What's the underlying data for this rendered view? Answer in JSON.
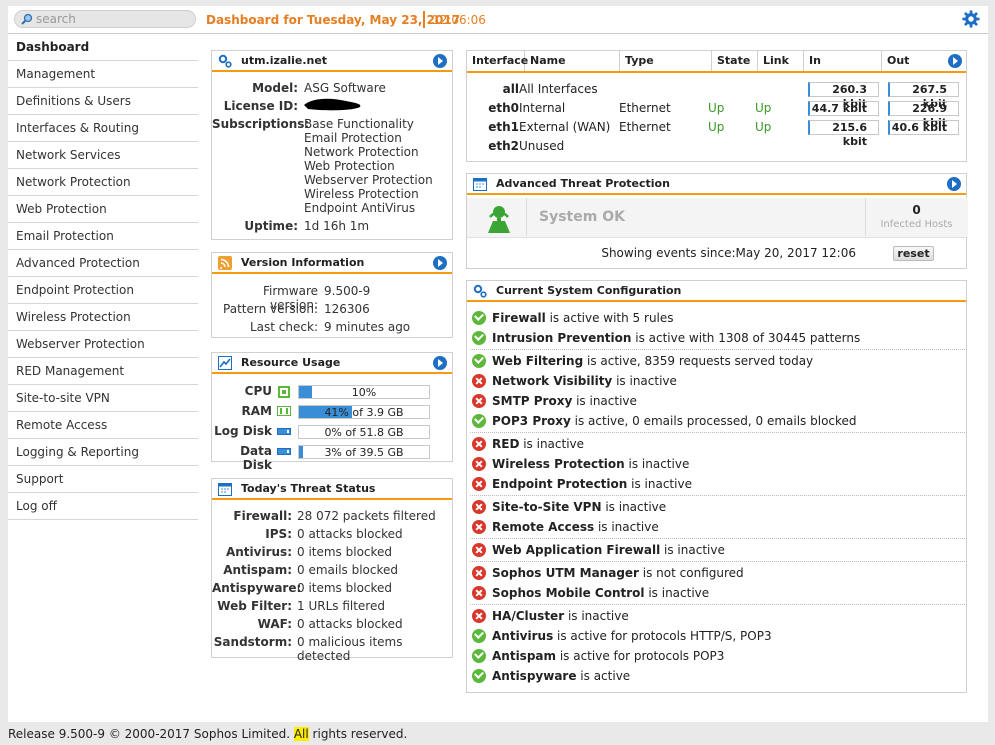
{
  "search": {
    "placeholder": "search"
  },
  "header": {
    "title": "Dashboard for Tuesday, May 23, 2017",
    "time": "12:06:06"
  },
  "sidebar": {
    "items": [
      {
        "label": "Dashboard"
      },
      {
        "label": "Management"
      },
      {
        "label": "Definitions & Users"
      },
      {
        "label": "Interfaces & Routing"
      },
      {
        "label": "Network Services"
      },
      {
        "label": "Network Protection"
      },
      {
        "label": "Web Protection"
      },
      {
        "label": "Email Protection"
      },
      {
        "label": "Advanced Protection"
      },
      {
        "label": "Endpoint Protection"
      },
      {
        "label": "Wireless Protection"
      },
      {
        "label": "Webserver Protection"
      },
      {
        "label": "RED Management"
      },
      {
        "label": "Site-to-site VPN"
      },
      {
        "label": "Remote Access"
      },
      {
        "label": "Logging & Reporting"
      },
      {
        "label": "Support"
      },
      {
        "label": "Log off"
      }
    ]
  },
  "system": {
    "title": "utm.izalie.net",
    "model_label": "Model:",
    "model": "ASG Software",
    "license_label": "License ID:",
    "subs_label": "Subscriptions:",
    "subscriptions": [
      "Base Functionality",
      "Email Protection",
      "Network Protection",
      "Web Protection",
      "Webserver Protection",
      "Wireless Protection",
      "Endpoint AntiVirus"
    ],
    "uptime_label": "Uptime:",
    "uptime": "1d 16h 1m"
  },
  "version": {
    "title": "Version Information",
    "firmware_label": "Firmware version:",
    "firmware": "9.500-9",
    "pattern_label": "Pattern version:",
    "pattern": "126306",
    "check_label": "Last check:",
    "check": "9 minutes ago"
  },
  "resources": {
    "title": "Resource Usage",
    "cpu": {
      "label": "CPU",
      "text": "10%",
      "pct": 10
    },
    "ram": {
      "label": "RAM",
      "text": "41% of 3.9 GB",
      "pct": 41
    },
    "logdisk": {
      "label": "Log Disk",
      "text": "0% of 51.8 GB",
      "pct": 0
    },
    "datadisk": {
      "label": "Data Disk",
      "text": "3% of 39.5 GB",
      "pct": 3
    }
  },
  "threat": {
    "title": "Today's Threat Status",
    "rows": [
      {
        "k": "Firewall:",
        "v": "28 072 packets filtered"
      },
      {
        "k": "IPS:",
        "v": "0 attacks blocked"
      },
      {
        "k": "Antivirus:",
        "v": "0 items blocked"
      },
      {
        "k": "Antispam:",
        "v": "0 emails blocked"
      },
      {
        "k": "Antispyware:",
        "v": "0 items blocked"
      },
      {
        "k": "Web Filter:",
        "v": "1 URLs filtered"
      },
      {
        "k": "WAF:",
        "v": "0 attacks blocked"
      },
      {
        "k": "Sandstorm:",
        "v": "0 malicious items detected"
      }
    ]
  },
  "interfaces": {
    "headers": {
      "interface": "Interface",
      "name": "Name",
      "type": "Type",
      "state": "State",
      "link": "Link",
      "in": "In",
      "out": "Out"
    },
    "rows": [
      {
        "iface": "all",
        "name": "All Interfaces",
        "type": "",
        "state": "",
        "link": "",
        "in": "260.3 kbit",
        "out": "267.5 kbit"
      },
      {
        "iface": "eth0",
        "name": "Internal",
        "type": "Ethernet",
        "state": "Up",
        "link": "Up",
        "in": "44.7 kbit",
        "out": "226.9 kbit"
      },
      {
        "iface": "eth1",
        "name": "External (WAN)",
        "type": "Ethernet",
        "state": "Up",
        "link": "Up",
        "in": "215.6 kbit",
        "out": "40.6 kbit"
      },
      {
        "iface": "eth2",
        "name": "Unused",
        "type": "",
        "state": "",
        "link": "",
        "in": "",
        "out": ""
      }
    ]
  },
  "atp": {
    "title": "Advanced Threat Protection",
    "status": "System OK",
    "count": "0",
    "count_label": "Infected Hosts",
    "since": "Showing events since:May 20, 2017 12:06",
    "reset": "reset"
  },
  "config": {
    "title": "Current System Configuration",
    "groups": [
      [
        {
          "ok": true,
          "name": "Firewall",
          "text": " is active with 5 rules"
        },
        {
          "ok": true,
          "name": "Intrusion Prevention",
          "text": " is active with 1308 of 30445 patterns"
        }
      ],
      [
        {
          "ok": true,
          "name": "Web Filtering",
          "text": " is active, 8359 requests served today"
        },
        {
          "ok": false,
          "name": "Network Visibility",
          "text": " is inactive"
        },
        {
          "ok": false,
          "name": "SMTP Proxy",
          "text": " is inactive"
        },
        {
          "ok": true,
          "name": "POP3 Proxy",
          "text": " is active, 0 emails processed, 0 emails blocked"
        }
      ],
      [
        {
          "ok": false,
          "name": "RED",
          "text": " is inactive"
        },
        {
          "ok": false,
          "name": "Wireless Protection",
          "text": " is inactive"
        },
        {
          "ok": false,
          "name": "Endpoint Protection",
          "text": " is inactive"
        }
      ],
      [
        {
          "ok": false,
          "name": "Site-to-Site VPN",
          "text": " is inactive"
        },
        {
          "ok": false,
          "name": "Remote Access",
          "text": " is inactive"
        }
      ],
      [
        {
          "ok": false,
          "name": "Web Application Firewall",
          "text": " is inactive"
        }
      ],
      [
        {
          "ok": false,
          "name": "Sophos UTM Manager",
          "text": " is not configured"
        },
        {
          "ok": false,
          "name": "Sophos Mobile Control",
          "text": " is inactive"
        }
      ],
      [
        {
          "ok": false,
          "name": "HA/Cluster",
          "text": " is inactive"
        },
        {
          "ok": true,
          "name": "Antivirus",
          "text": " is active for protocols HTTP/S, POP3"
        },
        {
          "ok": true,
          "name": "Antispam",
          "text": " is active for protocols POP3"
        },
        {
          "ok": true,
          "name": "Antispyware",
          "text": " is active"
        }
      ]
    ]
  },
  "footer": {
    "pre": "Release 9.500-9  © 2000-2017 Sophos Limited. ",
    "hl": "All",
    "post": " rights reserved."
  },
  "colors": {
    "accent": "#f39c12",
    "title": "#e67e22",
    "blue": "#1e6fc4",
    "ok": "#5cb83a",
    "bad": "#d9372b"
  }
}
